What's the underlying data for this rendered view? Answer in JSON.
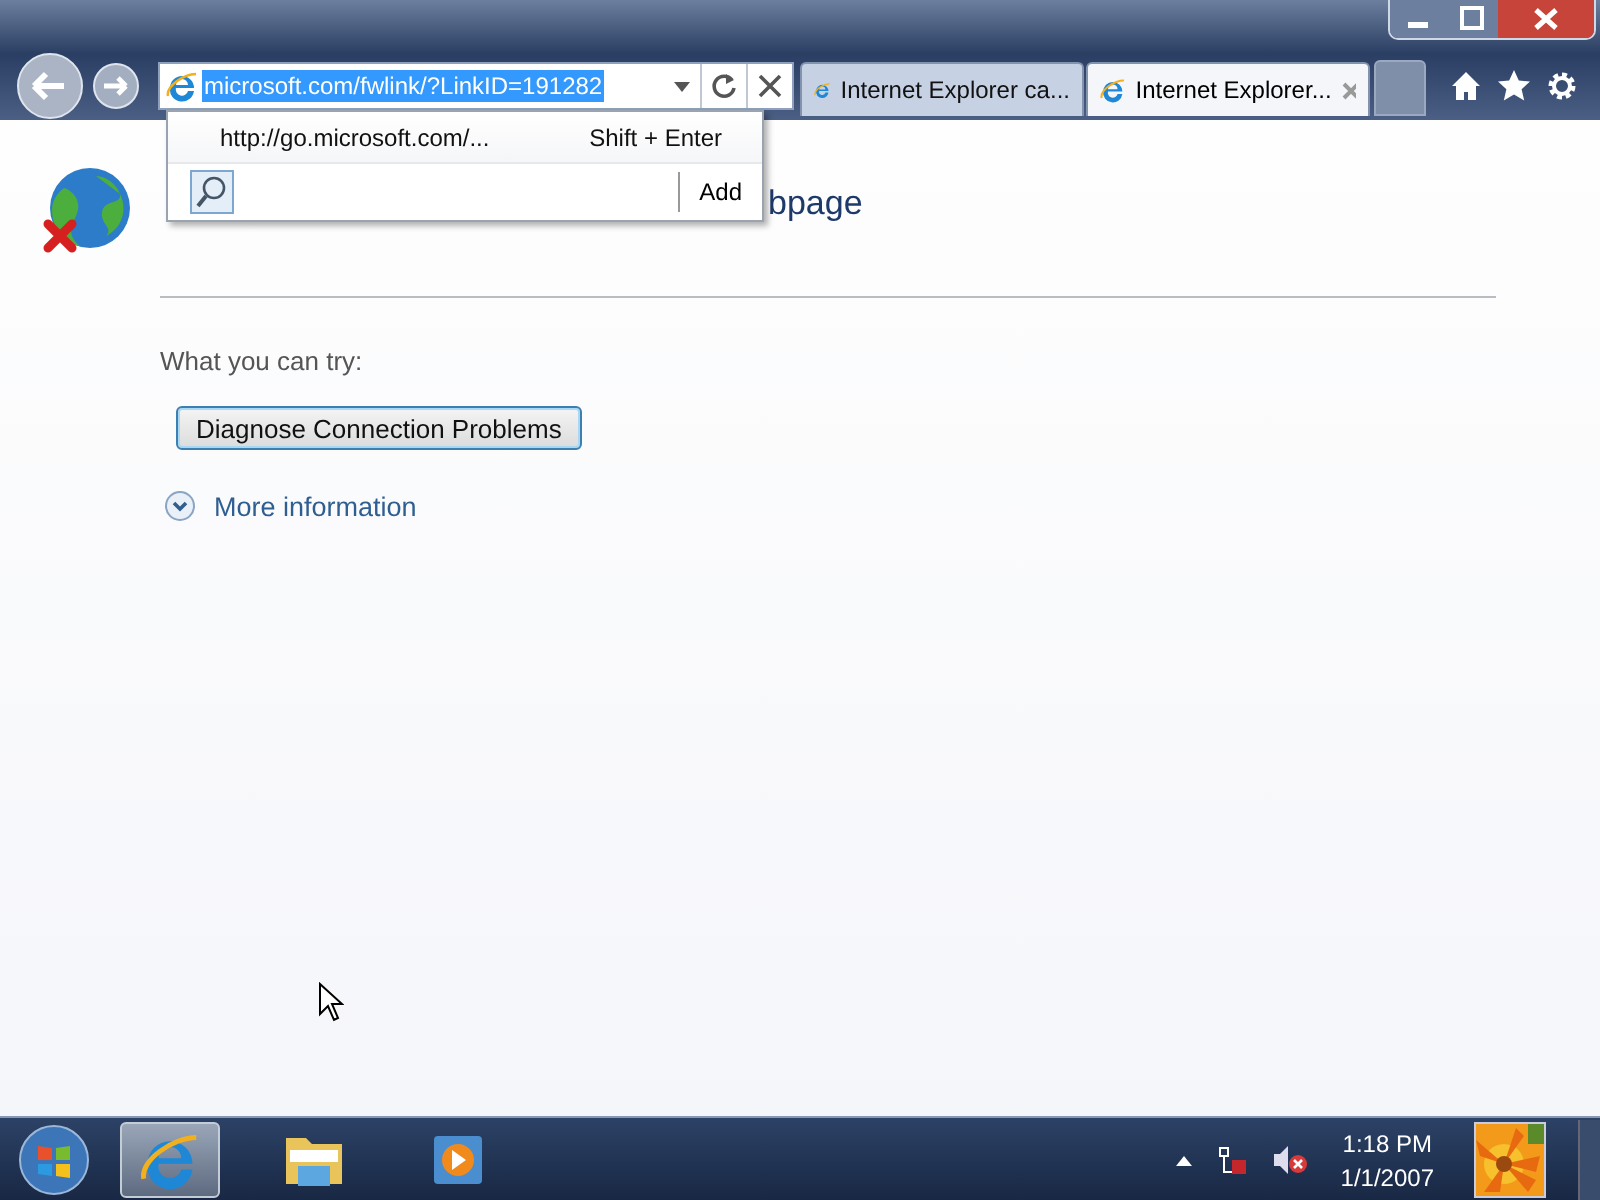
{
  "address_bar": {
    "url": "microsoft.com/fwlink/?LinkID=191282",
    "selected": true
  },
  "autocomplete": {
    "suggestion": "http://go.microsoft.com/...",
    "shortcut": "Shift + Enter",
    "add_button": "Add"
  },
  "tabs": [
    {
      "label": "Internet Explorer ca...",
      "selected": false
    },
    {
      "label": "Internet Explorer...",
      "selected": true
    }
  ],
  "page": {
    "heading_fragment": "bpage",
    "prompt": "What you can try:",
    "button": "Diagnose Connection Problems",
    "more_link": {
      "label": "More information",
      "expanded": false
    }
  },
  "taskbar": {
    "items": [
      {
        "kind": "browser",
        "selected": true
      },
      {
        "kind": "folder",
        "selected": false
      },
      {
        "kind": "media",
        "selected": false
      }
    ],
    "clock": {
      "time": "1:18 PM",
      "date": "1/1/2007"
    }
  }
}
